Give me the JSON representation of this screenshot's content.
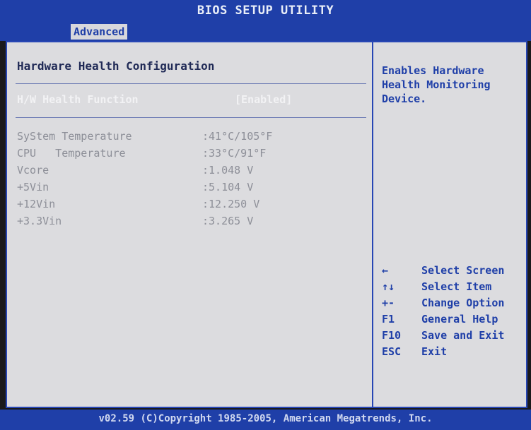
{
  "header": {
    "title": "BIOS SETUP UTILITY",
    "active_tab": "Advanced"
  },
  "main": {
    "section_title": "Hardware Health Configuration",
    "function": {
      "label": "H/W Health Function",
      "value": "[Enabled]"
    },
    "readings": [
      {
        "label": "SyStem Temperature",
        "value": ":41°C/105°F"
      },
      {
        "label": "CPU   Temperature",
        "value": ":33°C/91°F"
      },
      {
        "label": "Vcore",
        "value": ":1.048 V"
      },
      {
        "label": "+5Vin",
        "value": ":5.104 V"
      },
      {
        "label": "+12Vin",
        "value": ":12.250 V"
      },
      {
        "label": "+3.3Vin",
        "value": ":3.265 V"
      }
    ]
  },
  "help": {
    "text": "Enables Hardware Health Monitoring Device.",
    "keys": [
      {
        "key": "←",
        "desc": "Select Screen"
      },
      {
        "key": "↑↓",
        "desc": "Select Item"
      },
      {
        "key": "+-",
        "desc": "Change Option"
      },
      {
        "key": "F1",
        "desc": "General Help"
      },
      {
        "key": "F10",
        "desc": "Save and Exit"
      },
      {
        "key": "ESC",
        "desc": "Exit"
      }
    ]
  },
  "footer": {
    "text": "v02.59 (C)Copyright 1985-2005, American Megatrends, Inc."
  },
  "colors": {
    "bar_blue": "#1f3fa8",
    "panel_gray": "#dcdcdf",
    "highlight_text": "#f2f2f4",
    "dim_text": "#8d8f98"
  }
}
